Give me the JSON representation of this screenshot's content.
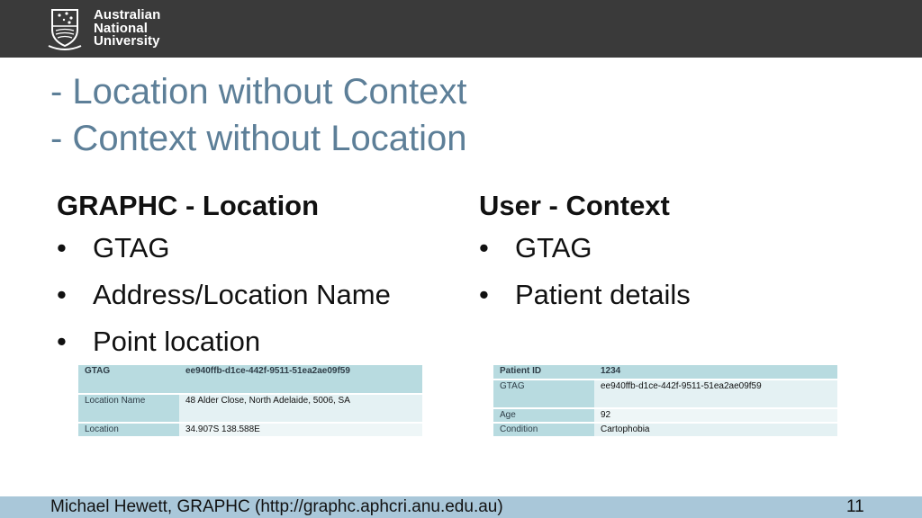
{
  "header": {
    "logo_lines": [
      "Australian",
      "National",
      "University"
    ]
  },
  "slide": {
    "title_lines": [
      "- Location without Context",
      "- Context without Location"
    ],
    "left": {
      "heading": "GRAPHC - Location",
      "bullets": [
        "GTAG",
        "Address/Location Name",
        "Point location"
      ],
      "table": [
        {
          "key": "GTAG",
          "value": "ee940ffb-d1ce-442f-9511-51ea2ae09f59"
        },
        {
          "key": "Location Name",
          "value": "48 Alder Close, North Adelaide, 5006, SA"
        },
        {
          "key": "Location",
          "value": "34.907S 138.588E"
        }
      ]
    },
    "right": {
      "heading": "User - Context",
      "bullets": [
        "GTAG",
        "Patient details"
      ],
      "table": [
        {
          "key": "Patient ID",
          "value": "1234"
        },
        {
          "key": "GTAG",
          "value": "ee940ffb-d1ce-442f-9511-51ea2ae09f59"
        },
        {
          "key": "Age",
          "value": "92"
        },
        {
          "key": "Condition",
          "value": "Cartophobia"
        }
      ]
    },
    "bullet_glyph": "•"
  },
  "footer": {
    "text": "Michael Hewett, GRAPHC (http://graphc.aphcri.anu.edu.au)",
    "page_number": "11"
  },
  "colors": {
    "header_bg": "#3a3a3a",
    "title": "#5d7f98",
    "table_key_bg": "#b8dbe0",
    "footer_bg": "#a9c7d9"
  },
  "icons": [
    "anu-crest-icon"
  ]
}
